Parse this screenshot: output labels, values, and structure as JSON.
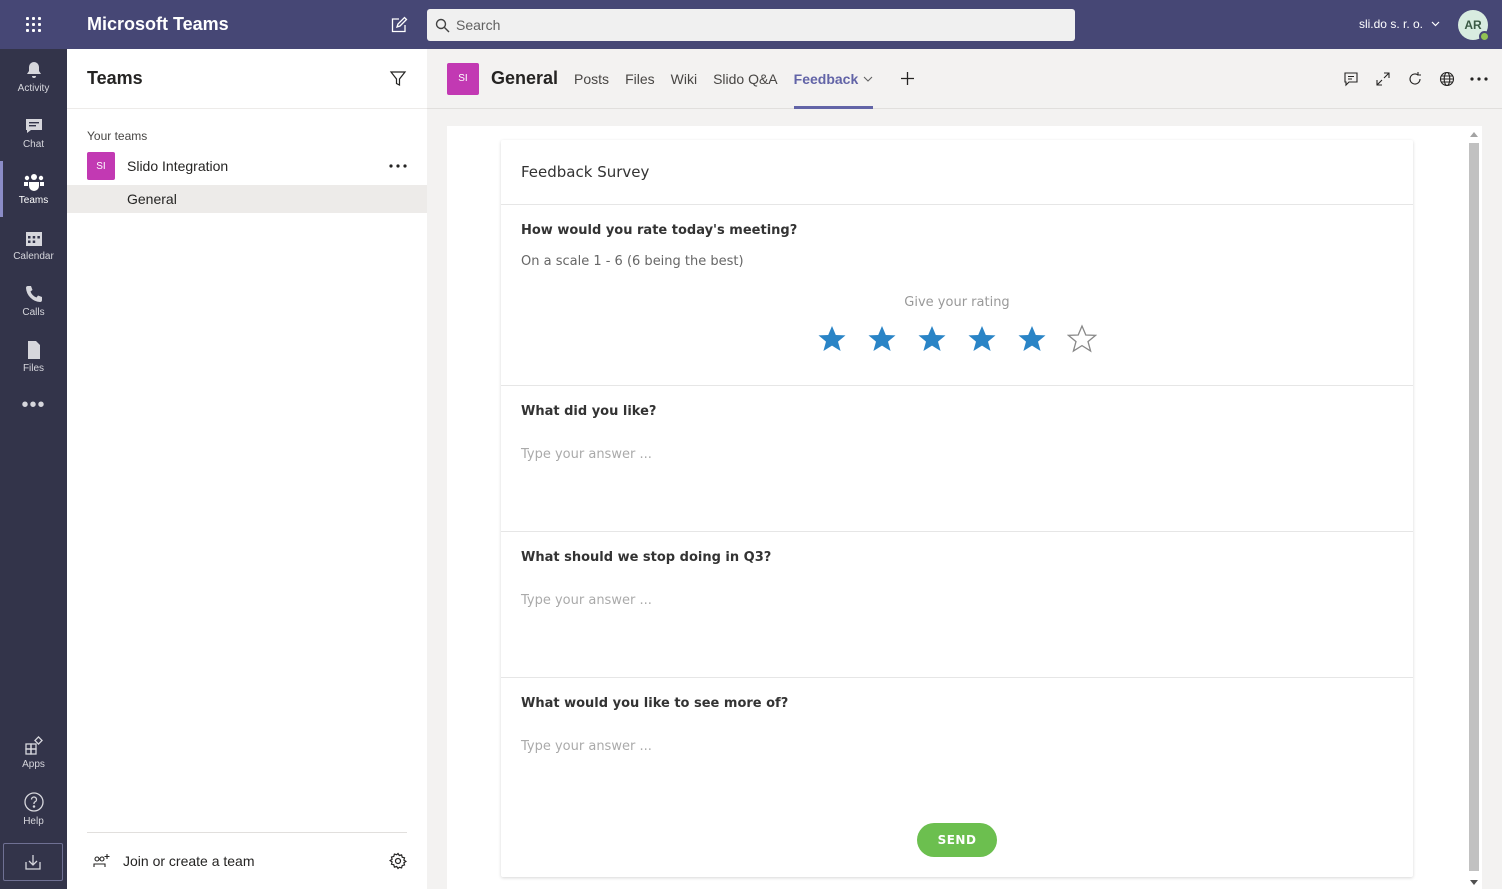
{
  "app": {
    "title": "Microsoft Teams"
  },
  "search": {
    "placeholder": "Search"
  },
  "account": {
    "org": "sli.do s. r. o.",
    "initials": "AR"
  },
  "rail": {
    "items": [
      {
        "label": "Activity",
        "icon": "bell-icon"
      },
      {
        "label": "Chat",
        "icon": "chat-icon"
      },
      {
        "label": "Teams",
        "icon": "teams-icon",
        "active": true
      },
      {
        "label": "Calendar",
        "icon": "calendar-icon"
      },
      {
        "label": "Calls",
        "icon": "phone-icon"
      },
      {
        "label": "Files",
        "icon": "file-icon"
      }
    ],
    "bottom": [
      {
        "label": "Apps",
        "icon": "apps-icon"
      },
      {
        "label": "Help",
        "icon": "help-icon"
      }
    ]
  },
  "teams_panel": {
    "title": "Teams",
    "section_label": "Your teams",
    "team": {
      "badge": "SI",
      "name": "Slido Integration"
    },
    "channel": "General",
    "join_label": "Join or create a team"
  },
  "channel": {
    "badge": "SI",
    "name": "General",
    "tabs": [
      "Posts",
      "Files",
      "Wiki",
      "Slido Q&A",
      "Feedback"
    ],
    "active_tab": "Feedback"
  },
  "survey": {
    "title": "Feedback Survey",
    "q1": {
      "title": "How would you rate today's meeting?",
      "desc": "On a scale 1 - 6 (6 being the best)",
      "rating_label": "Give your rating",
      "rating": 5,
      "max": 6
    },
    "q2": {
      "title": "What did you like?",
      "placeholder": "Type your answer ..."
    },
    "q3": {
      "title": "What should we stop doing in Q3?",
      "placeholder": "Type your answer ..."
    },
    "q4": {
      "title": "What would you like to see more of?",
      "placeholder": "Type your answer ..."
    },
    "send_label": "SEND"
  },
  "colors": {
    "titlebar": "#464775",
    "rail": "#33344a",
    "accent": "#6264a7",
    "team_badge": "#c239b3",
    "star_filled": "#2a84c6",
    "send": "#6cbf4f"
  }
}
